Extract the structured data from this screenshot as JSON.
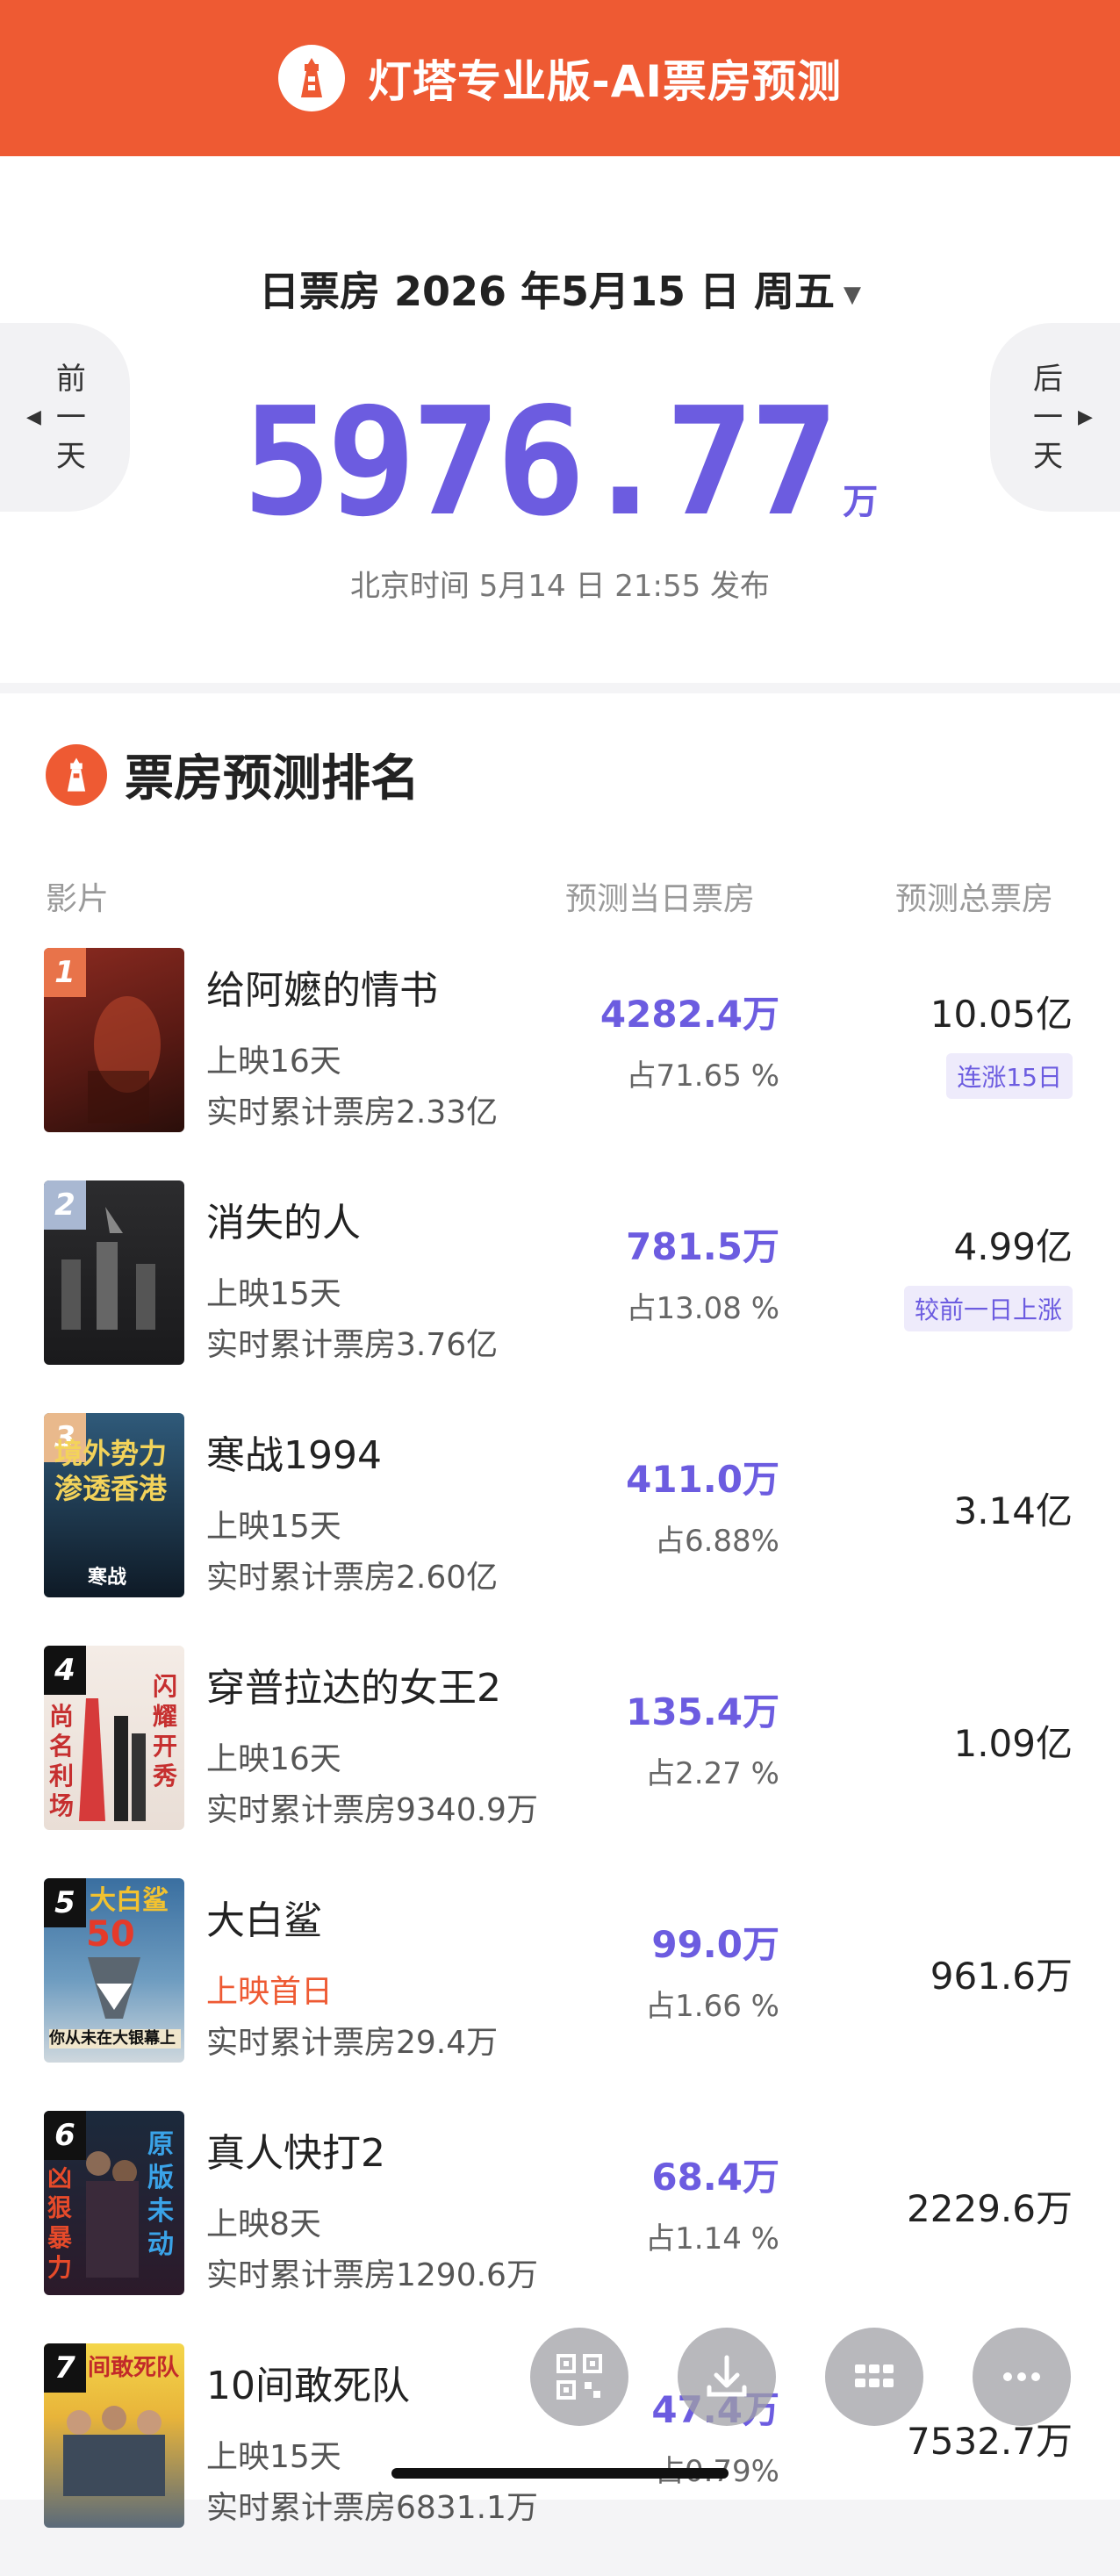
{
  "header": {
    "title": "灯塔专业版-AI票房预测",
    "accent": "#ee5a33"
  },
  "summary": {
    "date_label": "日票房 2026 年5月15 日 周五",
    "caret": "▼",
    "total_value": "5976.77",
    "total_unit": "万",
    "publish_text": "北京时间 5月14 日 21:55 发布",
    "prev_label": [
      "前",
      "一",
      "天"
    ],
    "next_label": [
      "后",
      "一",
      "天"
    ],
    "number_color": "#6c5ce0"
  },
  "ranking": {
    "title": "票房预测排名",
    "col_film": "影片",
    "col_day": "预测当日票房",
    "col_total": "预测总票房",
    "movies": [
      {
        "rank": "1",
        "name": "给阿嬷的情书",
        "days": "上映16天",
        "cumulative": "实时累计票房2.33亿",
        "day_box": "4282.4万",
        "share": "占71.65 %",
        "total": "10.05亿",
        "tag": "连涨15日"
      },
      {
        "rank": "2",
        "name": "消失的人",
        "days": "上映15天",
        "cumulative": "实时累计票房3.76亿",
        "day_box": "781.5万",
        "share": "占13.08 %",
        "total": "4.99亿",
        "tag": "较前一日上涨"
      },
      {
        "rank": "3",
        "name": "寒战1994",
        "days": "上映15天",
        "cumulative": "实时累计票房2.60亿",
        "day_box": "411.0万",
        "share": "占6.88%",
        "total": "3.14亿",
        "poster_text": "境外势力渗透香港",
        "poster_caption": "寒战"
      },
      {
        "rank": "4",
        "name": "穿普拉达的女王2",
        "days": "上映16天",
        "cumulative": "实时累计票房9340.9万",
        "day_box": "135.4万",
        "share": "占2.27 %",
        "total": "1.09亿",
        "poster_text_left": "尚名利场",
        "poster_text_right": "闪耀开秀"
      },
      {
        "rank": "5",
        "name": "大白鲨",
        "days": "上映首日",
        "cumulative": "实时累计票房29.4万",
        "day_box": "99.0万",
        "share": "占1.66 %",
        "total": "961.6万",
        "poster_title": "大白鲨",
        "poster_num": "50",
        "poster_caption": "你从未在大银幕上"
      },
      {
        "rank": "6",
        "name": "真人快打2",
        "days": "上映8天",
        "cumulative": "实时累计票房1290.6万",
        "day_box": "68.4万",
        "share": "占1.14 %",
        "total": "2229.6万",
        "poster_text_left": "凶狠暴力",
        "poster_text_right": "原版未动"
      },
      {
        "rank": "7",
        "name": "10间敢死队",
        "days": "上映15天",
        "cumulative": "实时累计票房6831.1万",
        "day_box": "47.4万",
        "share": "占0.79%",
        "total": "7532.7万",
        "poster_title": "间敢死队"
      }
    ]
  },
  "floating_buttons": [
    "qr-code-icon",
    "download-icon",
    "grid-icon",
    "more-icon"
  ]
}
